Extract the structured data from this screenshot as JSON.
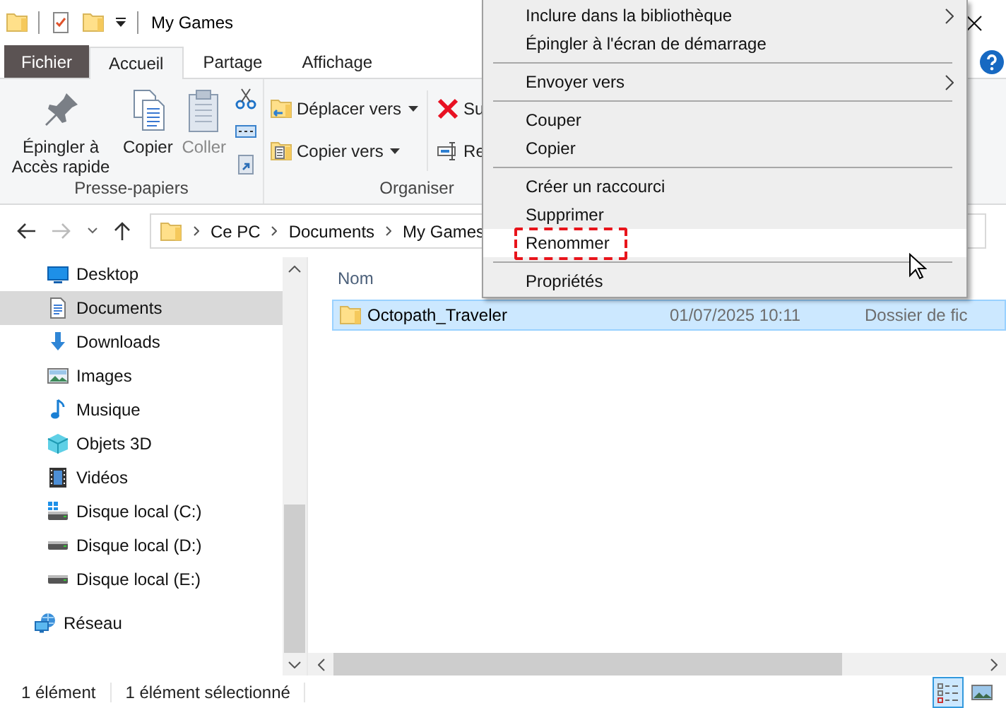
{
  "window": {
    "title": "My Games"
  },
  "ribbon": {
    "tabs": [
      {
        "label": "Fichier",
        "kind": "file",
        "selected": false
      },
      {
        "label": "Accueil",
        "kind": "tab",
        "selected": true
      },
      {
        "label": "Partage",
        "kind": "tab",
        "selected": false
      },
      {
        "label": "Affichage",
        "kind": "tab",
        "selected": false
      }
    ],
    "groups": [
      {
        "label": "Presse-papiers",
        "buttons": [
          {
            "label": "Épingler à Accès rapide",
            "kind": "pin",
            "disabled": false
          },
          {
            "label": "Copier",
            "kind": "copy",
            "disabled": false
          },
          {
            "label": "Coller",
            "kind": "paste",
            "disabled": true
          }
        ]
      },
      {
        "label": "Organiser",
        "buttons": [
          {
            "label": "Déplacer vers",
            "kind": "move",
            "dropdown": true
          },
          {
            "label": "Copier vers",
            "kind": "copyto",
            "dropdown": true
          },
          {
            "label": "Su",
            "kind": "delete",
            "dropdown": false
          },
          {
            "label": "Re",
            "kind": "rename",
            "dropdown": false
          }
        ]
      }
    ]
  },
  "address": {
    "crumbs": [
      "Ce PC",
      "Documents",
      "My Games"
    ]
  },
  "nav": {
    "groups": [
      {
        "items": [
          {
            "label": "Desktop",
            "kind": "desktop",
            "selected": false
          },
          {
            "label": "Documents",
            "kind": "documents",
            "selected": true
          },
          {
            "label": "Downloads",
            "kind": "downloads",
            "selected": false
          },
          {
            "label": "Images",
            "kind": "images",
            "selected": false
          },
          {
            "label": "Musique",
            "kind": "music",
            "selected": false
          },
          {
            "label": "Objets 3D",
            "kind": "cube",
            "selected": false
          },
          {
            "label": "Vidéos",
            "kind": "videos",
            "selected": false
          },
          {
            "label": "Disque local (C:)",
            "kind": "system-drive",
            "selected": false
          },
          {
            "label": "Disque local (D:)",
            "kind": "drive",
            "selected": false
          },
          {
            "label": "Disque local (E:)",
            "kind": "drive",
            "selected": false
          }
        ]
      },
      {
        "items": [
          {
            "label": "Réseau",
            "kind": "network",
            "selected": false
          }
        ]
      }
    ]
  },
  "files": {
    "columns": [
      {
        "label": "Nom"
      }
    ],
    "rows": [
      {
        "name": "Octopath_Traveler",
        "date": "01/07/2025 10:11",
        "type": "Dossier de fic",
        "selected": true
      }
    ]
  },
  "status": {
    "texts": [
      "1 élément",
      "1 élément sélectionné"
    ],
    "views": [
      {
        "kind": "details",
        "selected": true
      },
      {
        "kind": "large-icons",
        "selected": false
      }
    ]
  },
  "context_menu": {
    "groups": [
      {
        "items": [
          {
            "label": "Inclure dans la bibliothèque",
            "submenu": true,
            "selected": false,
            "outlined": false
          },
          {
            "label": "Épingler à l'écran de démarrage",
            "submenu": false,
            "selected": false,
            "outlined": false
          }
        ]
      },
      {
        "items": [
          {
            "label": "Envoyer vers",
            "submenu": true,
            "selected": false,
            "outlined": false
          }
        ]
      },
      {
        "items": [
          {
            "label": "Couper",
            "submenu": false,
            "selected": false,
            "outlined": false
          },
          {
            "label": "Copier",
            "submenu": false,
            "selected": false,
            "outlined": false
          }
        ]
      },
      {
        "items": [
          {
            "label": "Créer un raccourci",
            "submenu": false,
            "selected": false,
            "outlined": false
          },
          {
            "label": "Supprimer",
            "submenu": false,
            "selected": false,
            "outlined": false
          },
          {
            "label": "Renommer",
            "submenu": false,
            "selected": true,
            "outlined": true
          }
        ]
      },
      {
        "items": [
          {
            "label": "Propriétés",
            "submenu": false,
            "selected": false,
            "outlined": false
          }
        ]
      }
    ]
  }
}
